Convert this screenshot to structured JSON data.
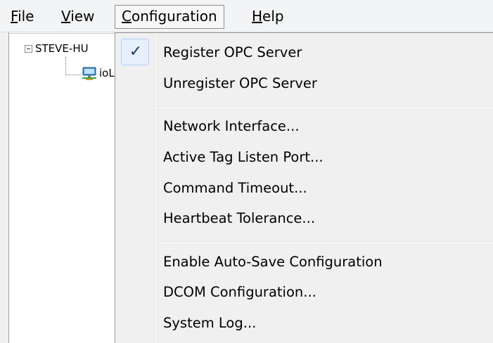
{
  "menubar": {
    "file": {
      "accel": "F",
      "rest": "ile"
    },
    "view": {
      "accel": "V",
      "rest": "iew"
    },
    "configuration": {
      "accel": "C",
      "rest": "onfiguration"
    },
    "help": {
      "accel": "H",
      "rest": "elp"
    }
  },
  "tree": {
    "root_label": "STEVE-HU",
    "child_label": "ioL"
  },
  "dropdown": {
    "items": [
      {
        "label": "Register OPC Server",
        "checked": true
      },
      {
        "label": "Unregister OPC Server"
      },
      {
        "label": "Network Interface..."
      },
      {
        "label": "Active Tag Listen Port..."
      },
      {
        "label": "Command Timeout..."
      },
      {
        "label": "Heartbeat Tolerance..."
      },
      {
        "label": "Enable Auto-Save Configuration"
      },
      {
        "label": "DCOM Configuration..."
      },
      {
        "label": "System Log..."
      }
    ],
    "check_glyph": "✓"
  },
  "colors": {
    "menubar_bg": "#f3f4f6",
    "menu_bg": "#f0f0f0",
    "check_highlight": "#e6f0fa"
  }
}
